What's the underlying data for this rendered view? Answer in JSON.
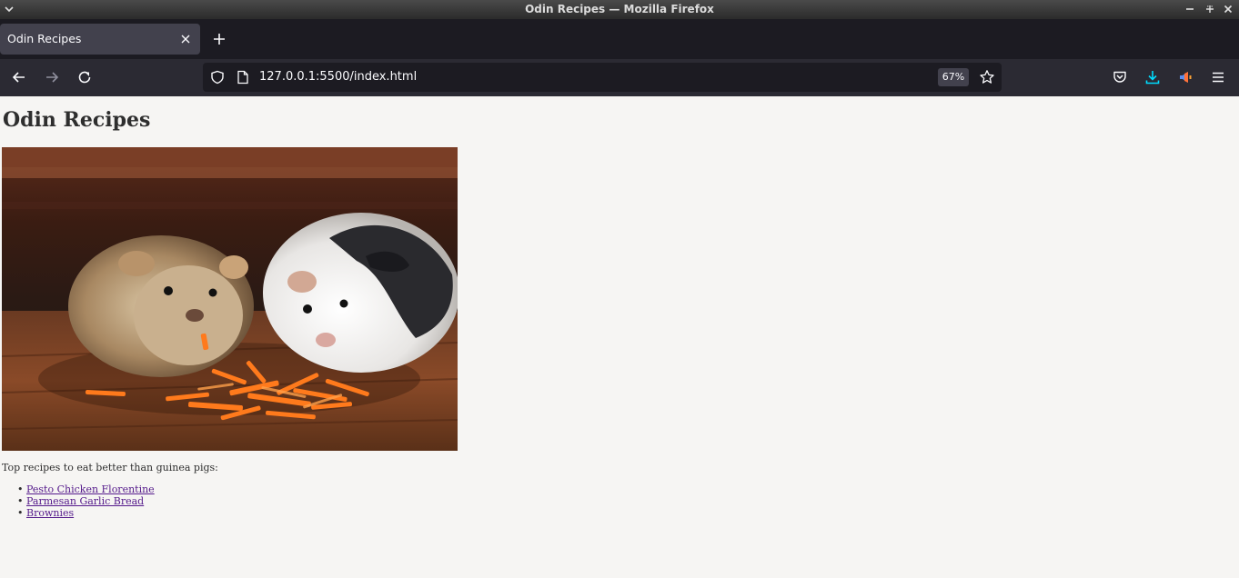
{
  "window": {
    "title": "Odin Recipes — Mozilla Firefox"
  },
  "tabs": [
    {
      "label": "Odin Recipes",
      "active": true
    }
  ],
  "navbar": {
    "url": "127.0.0.1:5500/index.html",
    "zoom": "67%"
  },
  "page": {
    "heading": "Odin Recipes",
    "image_icon": "guinea-pigs-eating-carrots-image",
    "intro": "Top recipes to eat better than guinea pigs:",
    "recipes": [
      {
        "label": "Pesto Chicken Florentine"
      },
      {
        "label": "Parmesan Garlic Bread"
      },
      {
        "label": "Brownies"
      }
    ]
  },
  "colors": {
    "chrome_dark": "#1c1b22",
    "toolbar": "#2b2a33",
    "tab_active": "#42414d",
    "page_bg": "#f6f5f3",
    "visited_link": "#551a8b",
    "download_accent": "#00ddff"
  }
}
